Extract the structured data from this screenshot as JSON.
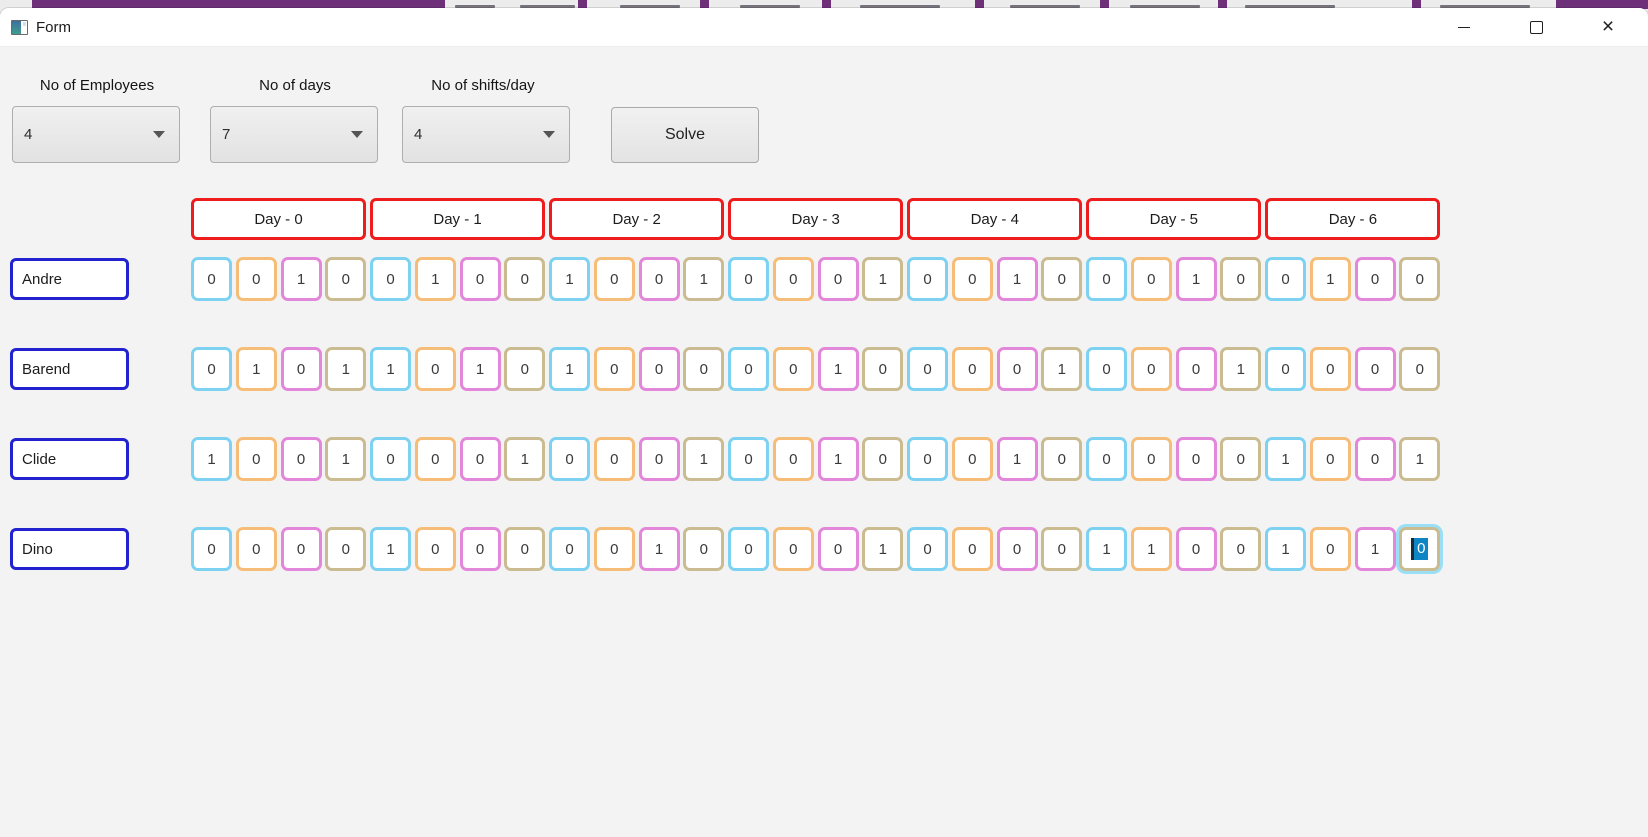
{
  "window": {
    "title": "Form",
    "controls": [
      "minimize",
      "maximize",
      "close"
    ]
  },
  "toolbar": {
    "fields": [
      {
        "label": "No of Employees",
        "value": "4"
      },
      {
        "label": "No of days",
        "value": "7"
      },
      {
        "label": "No of shifts/day",
        "value": "4"
      }
    ],
    "solve_label": "Solve"
  },
  "schedule": {
    "day_headers": [
      "Day - 0",
      "Day - 1",
      "Day - 2",
      "Day - 3",
      "Day - 4",
      "Day - 5",
      "Day - 6"
    ],
    "shifts_per_day": 4,
    "rows": [
      {
        "name": "Andre",
        "values": [
          0,
          0,
          1,
          0,
          0,
          1,
          0,
          0,
          1,
          0,
          0,
          1,
          0,
          0,
          0,
          1,
          0,
          0,
          1,
          0,
          0,
          0,
          1,
          0,
          0,
          1,
          0,
          0
        ]
      },
      {
        "name": "Barend",
        "values": [
          0,
          1,
          0,
          1,
          1,
          0,
          1,
          0,
          1,
          0,
          0,
          0,
          0,
          0,
          1,
          0,
          0,
          0,
          0,
          1,
          0,
          0,
          0,
          1,
          0,
          0,
          0,
          0
        ]
      },
      {
        "name": "Clide",
        "values": [
          1,
          0,
          0,
          1,
          0,
          0,
          0,
          1,
          0,
          0,
          0,
          1,
          0,
          0,
          1,
          0,
          0,
          0,
          1,
          0,
          0,
          0,
          0,
          0,
          1,
          0,
          0,
          1
        ]
      },
      {
        "name": "Dino",
        "values": [
          0,
          0,
          0,
          0,
          1,
          0,
          0,
          0,
          0,
          0,
          1,
          0,
          0,
          0,
          0,
          1,
          0,
          0,
          0,
          0,
          1,
          1,
          0,
          0,
          1,
          0,
          1,
          0
        ]
      }
    ],
    "selection": {
      "employee": "Dino",
      "row_index": 3,
      "cell_index": 27,
      "value": "0"
    }
  },
  "colors": {
    "shift_borders": [
      "#7ed2f1",
      "#f6bd79",
      "#e287d9",
      "#cabc90"
    ],
    "day_header_border": "#ee1c1c",
    "employee_border": "#2222cf",
    "selection_highlight": "#0e85c4",
    "background_strip_purple": "#6e3179"
  }
}
